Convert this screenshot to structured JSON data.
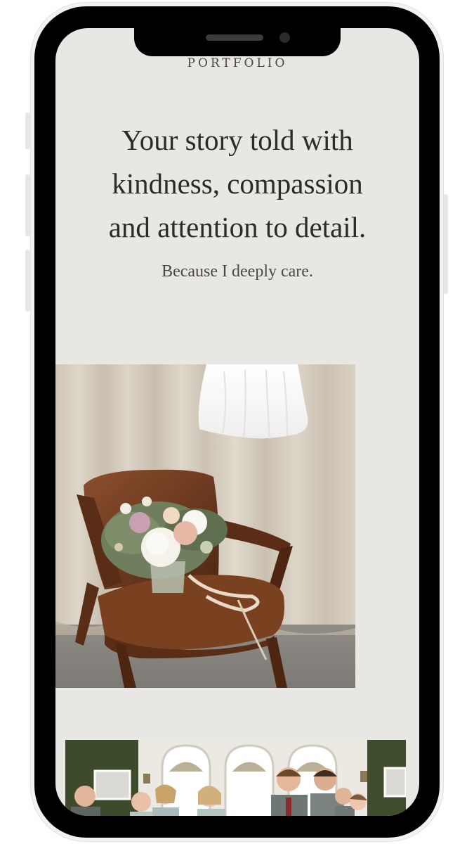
{
  "nav": {
    "label": "PORTFOLIO"
  },
  "hero": {
    "headline_lines": [
      "Your story told with",
      "kindness, compassion",
      "and attention to detail."
    ],
    "subline": "Because I deeply care."
  },
  "images": {
    "chair_photo_icon": "photo-wedding-chair-bouquet",
    "group_photo_icon": "photo-wedding-party-group"
  },
  "colors": {
    "screen_background": "#e9e7e4",
    "text_primary": "#2d2b2a",
    "text_secondary": "#4a4745"
  }
}
